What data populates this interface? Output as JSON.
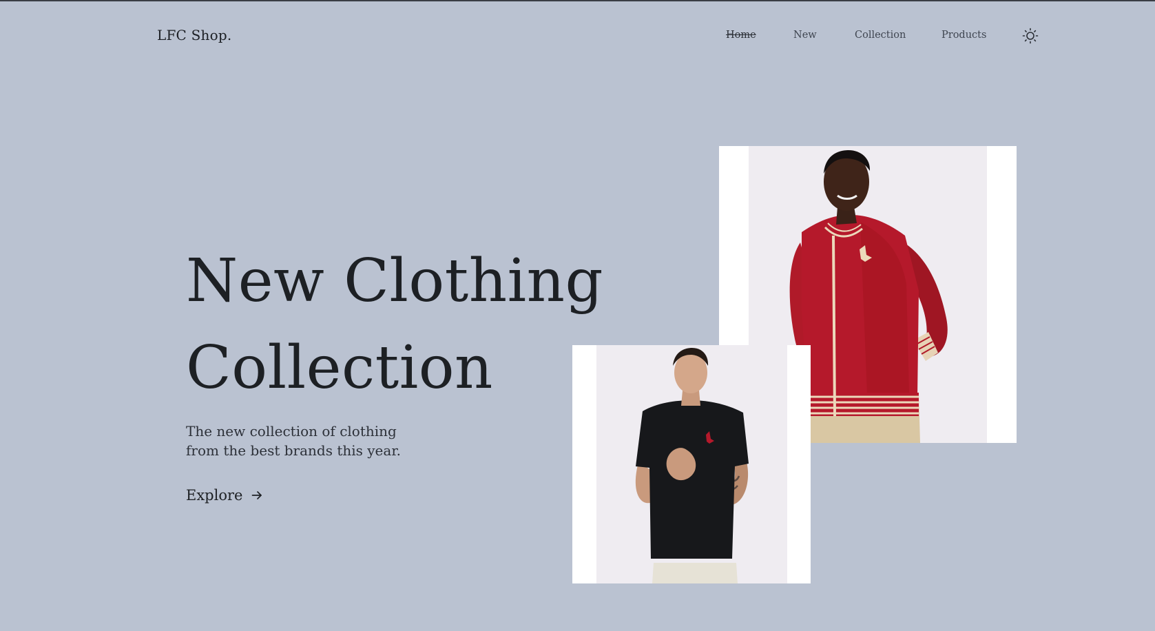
{
  "header": {
    "brand": "LFC Shop.",
    "nav": [
      {
        "label": "Home",
        "active": true
      },
      {
        "label": "New",
        "active": false
      },
      {
        "label": "Collection",
        "active": false
      },
      {
        "label": "Products",
        "active": false
      }
    ],
    "theme_icon": "sun-icon"
  },
  "hero": {
    "title_line1": "New Clothing",
    "title_line2": "Collection",
    "subtitle": "The new collection of clothing from the best brands this year.",
    "cta_label": "Explore",
    "cta_icon": "arrow-right-icon"
  },
  "images": {
    "primary_alt": "Model wearing red LFC track jacket",
    "secondary_alt": "Model wearing black LFC t-shirt"
  },
  "colors": {
    "background": "#bac2d1",
    "jacket_red": "#b5192b",
    "shirt_black": "#17181b"
  }
}
